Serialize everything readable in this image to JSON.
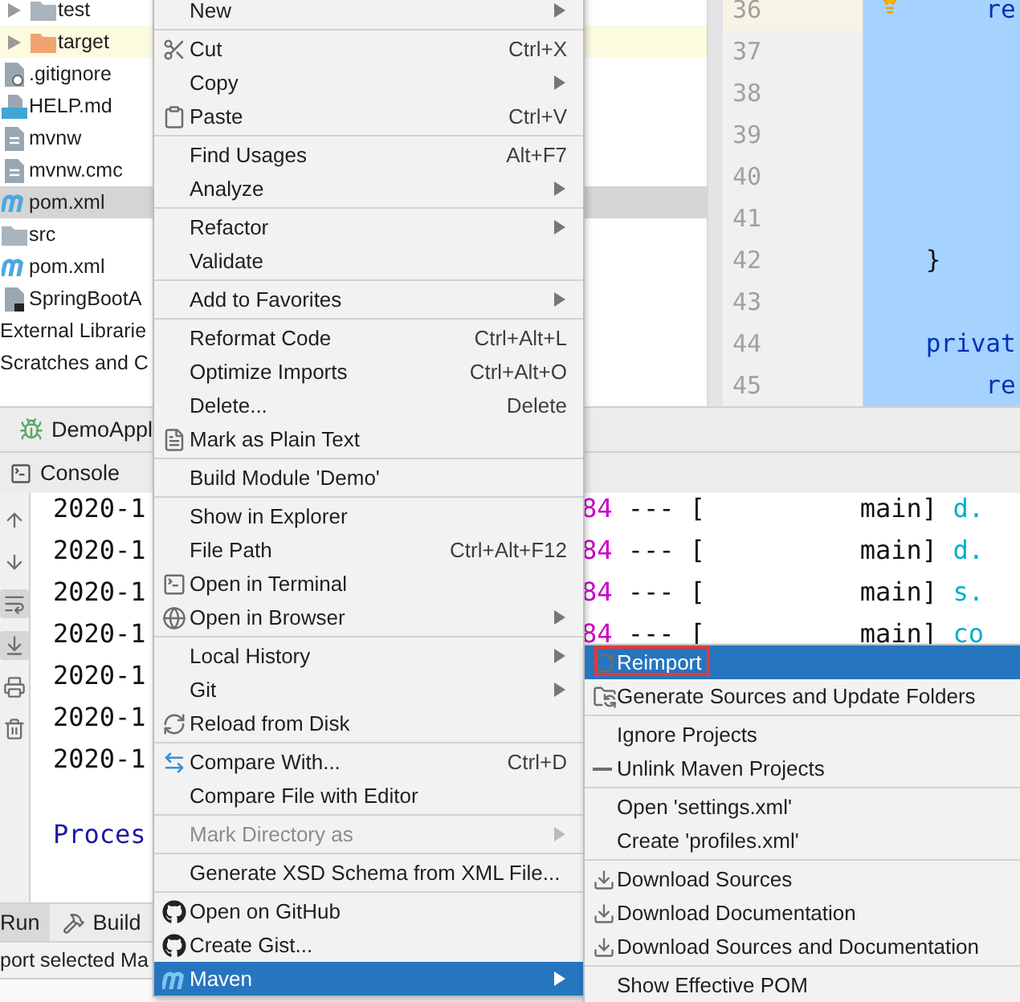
{
  "project_tree": [
    {
      "children": [
        {
          "children": [
            {
              "children": [
                {
                  "label": "test",
                  "kind": "folder",
                  "expanded": false,
                  "selected": false
                }
              ]
            },
            {
              "label": "target",
              "kind": "excluded-folder",
              "expanded": false,
              "selected": false
            },
            {
              "label": ".gitignore",
              "kind": "ignore-file",
              "selected": false
            },
            {
              "label": "HELP.md",
              "kind": "markdown-file",
              "selected": false
            },
            {
              "label": "mvnw",
              "kind": "text-file",
              "selected": false
            },
            {
              "label": "mvnw.cmc",
              "kind": "text-file",
              "selected": false
            },
            {
              "label": "pom.xml",
              "kind": "maven-file",
              "selected": true
            }
          ]
        },
        {
          "label": "src",
          "kind": "folder",
          "selected": false
        },
        {
          "label": "pom.xml",
          "kind": "maven-file",
          "selected": false
        },
        {
          "label": "SpringBootA",
          "kind": "script-file",
          "selected": false
        }
      ]
    },
    {
      "label": "External Librarie",
      "selected": false
    },
    {
      "label": "Scratches and C",
      "selected": false
    }
  ],
  "editor": {
    "lines": [
      {
        "number": "36",
        "code": "        re"
      },
      {
        "number": "37"
      },
      {
        "number": "38"
      },
      {
        "number": "39"
      },
      {
        "number": "40"
      },
      {
        "number": "41"
      },
      {
        "number": "42",
        "code": "    }"
      },
      {
        "number": "43"
      },
      {
        "number": "44",
        "code": "    privat"
      },
      {
        "number": "45",
        "code": "        re"
      }
    ]
  },
  "run_tab": "DemoAppl",
  "console_tab": "Console",
  "console": {
    "tools": [
      {
        "on": false
      },
      {
        "on": false
      },
      {
        "on": true
      },
      {
        "on": true
      },
      {
        "on": false
      },
      {
        "on": false
      }
    ],
    "lines": [
      {
        "time": "2020-1",
        "pid": "84",
        "thread": " --- [          main] ",
        "logger": "d."
      },
      {
        "time": "2020-1",
        "pid": "84",
        "thread": " --- [          main] ",
        "logger": "d."
      },
      {
        "time": "2020-1",
        "pid": "84",
        "thread": " --- [          main] ",
        "logger": "s."
      },
      {
        "time": "2020-1",
        "pid": "84",
        "thread": " --- [          main] ",
        "logger": "co"
      },
      {
        "time": "2020-1"
      },
      {
        "time": "2020-1"
      },
      {
        "time": "2020-1"
      }
    ],
    "footer": "Proces"
  },
  "bottom_tabs": [
    {
      "label": "Run",
      "selected": true
    },
    {
      "label": "Build",
      "selected": false
    }
  ],
  "status_bar": "port selected Ma",
  "context_menu": {
    "groups": [
      {
        "items": [
          {
            "label": "New",
            "submenu": true
          }
        ]
      },
      {
        "items": [
          {
            "label": "Cut",
            "shortcut": "Ctrl+X"
          },
          {
            "label": "Copy",
            "submenu": true
          },
          {
            "label": "Paste",
            "shortcut": "Ctrl+V"
          }
        ]
      },
      {
        "items": [
          {
            "label": "Find Usages",
            "shortcut": "Alt+F7"
          },
          {
            "label": "Analyze",
            "submenu": true
          }
        ]
      },
      {
        "items": [
          {
            "label": "Refactor",
            "submenu": true
          },
          {
            "label": "Validate"
          }
        ]
      },
      {
        "items": [
          {
            "label": "Add to Favorites",
            "submenu": true
          }
        ]
      },
      {
        "items": [
          {
            "label": "Reformat Code",
            "shortcut": "Ctrl+Alt+L"
          },
          {
            "label": "Optimize Imports",
            "shortcut": "Ctrl+Alt+O"
          },
          {
            "label": "Delete...",
            "shortcut": "Delete"
          },
          {
            "label": "Mark as Plain Text"
          }
        ]
      },
      {
        "items": [
          {
            "label": "Build Module 'Demo'"
          }
        ]
      },
      {
        "items": [
          {
            "label": "Show in Explorer"
          },
          {
            "label": "File Path",
            "shortcut": "Ctrl+Alt+F12"
          },
          {
            "label": "Open in Terminal"
          },
          {
            "label": "Open in Browser",
            "submenu": true
          }
        ]
      },
      {
        "items": [
          {
            "label": "Local History",
            "submenu": true
          },
          {
            "label": "Git",
            "submenu": true
          },
          {
            "label": "Reload from Disk"
          }
        ]
      },
      {
        "items": [
          {
            "label": "Compare With...",
            "shortcut": "Ctrl+D"
          },
          {
            "label": "Compare File with Editor"
          }
        ]
      },
      {
        "items": [
          {
            "label": "Mark Directory as",
            "submenu": true,
            "disabled": true
          }
        ]
      },
      {
        "items": [
          {
            "label": "Generate XSD Schema from XML File..."
          }
        ]
      },
      {
        "items": [
          {
            "label": "Open on GitHub"
          },
          {
            "label": "Create Gist..."
          },
          {
            "label": "Maven",
            "submenu": true,
            "selected": true
          }
        ]
      }
    ]
  },
  "maven_submenu": {
    "groups": [
      {
        "items": [
          {
            "label": "Reimport",
            "selected": true,
            "framed": true
          },
          {
            "label": "Generate Sources and Update Folders"
          }
        ]
      },
      {
        "items": [
          {
            "label": "Ignore Projects"
          },
          {
            "label": "Unlink Maven Projects"
          }
        ]
      },
      {
        "items": [
          {
            "label": "Open 'settings.xml'"
          },
          {
            "label": "Create 'profiles.xml'"
          }
        ]
      },
      {
        "items": [
          {
            "label": "Download Sources"
          },
          {
            "label": "Download Documentation"
          },
          {
            "label": "Download Sources and Documentation"
          }
        ]
      },
      {
        "items": [
          {
            "label": "Show Effective POM"
          }
        ]
      }
    ]
  }
}
